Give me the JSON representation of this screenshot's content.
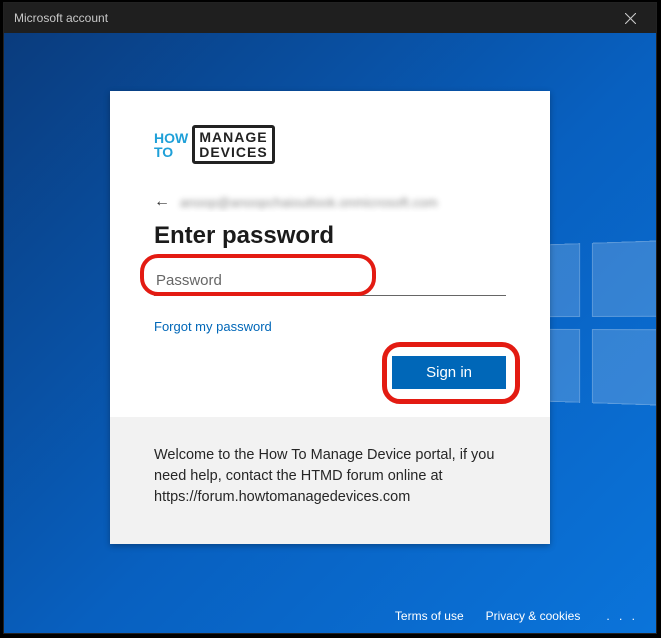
{
  "window": {
    "title": "Microsoft account"
  },
  "logo": {
    "how": "HOW",
    "to": "TO",
    "line1": "MANAGE",
    "line2": "DEVICES"
  },
  "identity": {
    "email": "anoop@anoopchaioutlook.onmicrosoft.com"
  },
  "heading": "Enter password",
  "password": {
    "placeholder": "Password",
    "value": ""
  },
  "links": {
    "forgot": "Forgot my password"
  },
  "buttons": {
    "signin": "Sign in"
  },
  "info": {
    "text": "Welcome to the How To Manage Device portal, if you need help, contact the HTMD forum online at https://forum.howtomanagedevices.com"
  },
  "footer": {
    "terms": "Terms of use",
    "privacy": "Privacy & cookies",
    "more": ". . ."
  },
  "colors": {
    "accent": "#0067b8",
    "annotRed": "#e31b12"
  }
}
